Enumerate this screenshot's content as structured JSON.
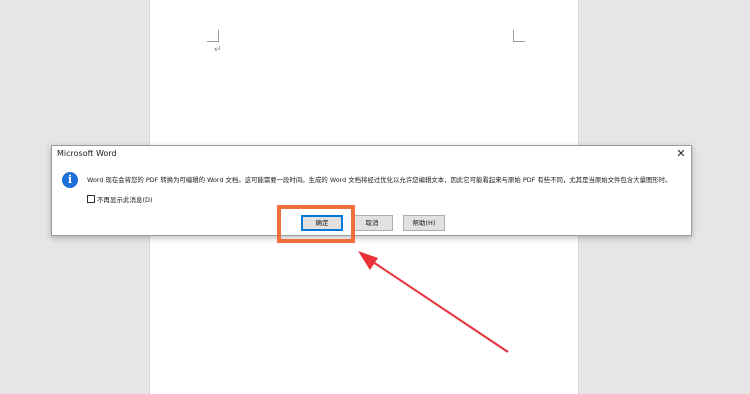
{
  "document": {
    "paragraph_mark": "↵"
  },
  "dialog": {
    "title": "Microsoft Word",
    "close_glyph": "✕",
    "info_glyph": "i",
    "message": "Word 现在会将您的 PDF 转换为可编辑的 Word 文档。这可能需要一段时间。生成的 Word 文档将经过优化以允许您编辑文本，因此它可能看起来与原始 PDF 有些不同，尤其是当原始文件包含大量图形时。",
    "checkbox_label": "不再显示此消息(D)",
    "checkbox_checked": false,
    "buttons": {
      "ok": "确定",
      "cancel": "取消",
      "help": "帮助(H)"
    }
  },
  "annotation": {
    "highlight_color": "#f07040",
    "arrow_color": "#e8323a"
  },
  "icons": [
    "info-icon",
    "close-icon",
    "page-corner-icon",
    "paragraph-mark-icon"
  ]
}
